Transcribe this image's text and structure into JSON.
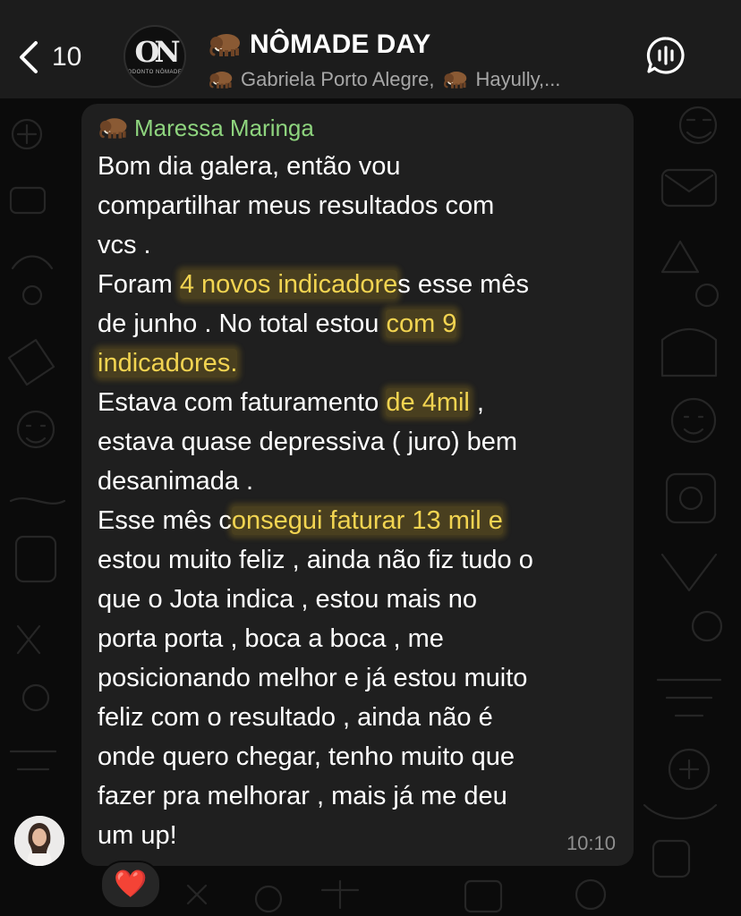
{
  "header": {
    "back_count": "10",
    "group_logo_main": "ON",
    "group_logo_sub": "ODONTO NÔMADE",
    "group_title": "NÔMADE DAY",
    "member_1": "Gabriela Porto Alegre,",
    "member_2": "Hayully,...",
    "icons": {
      "back": "chevron-left-icon",
      "member_emoji": "mammoth-icon",
      "voice": "voice-chat-icon"
    }
  },
  "message": {
    "sender": "Maressa Maringa",
    "lines": [
      "Bom dia galera, então vou",
      "compartilhar meus resultados com",
      "vcs .",
      [
        "Foram ",
        "4 novos indicadore",
        "s esse mês"
      ],
      [
        "de junho . No total estou ",
        "com 9"
      ],
      [
        "indicadores."
      ],
      [
        "Estava com faturamento ",
        "de 4mil",
        " ,"
      ],
      "estava quase depressiva ( juro) bem",
      "desanimada .",
      [
        "Esse mês c",
        "onsegui faturar 13 mil e"
      ],
      "estou muito feliz , ainda não fiz tudo o",
      "que o Jota indica , estou mais no",
      "porta porta , boca a boca , me",
      "posicionando melhor e já estou muito",
      "feliz com o resultado , ainda não é",
      "onde quero chegar, tenho muito que",
      "fazer pra melhorar , mais já me deu",
      "um up!"
    ],
    "time": "10:10",
    "reaction": "❤️"
  },
  "colors": {
    "background": "#0b0b0b",
    "header": "#1c1c1c",
    "bubble": "#1f1f1f",
    "sender_name": "#8ed47e",
    "highlight": "#f2d451",
    "timestamp": "#8f8f8f"
  }
}
